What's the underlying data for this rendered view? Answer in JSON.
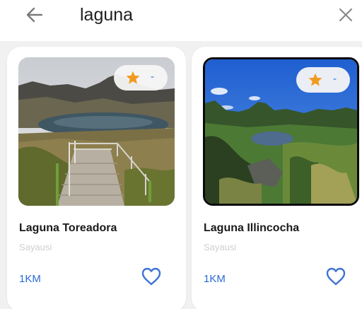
{
  "header": {
    "search_query": "laguna",
    "back_icon": "arrow-left-icon",
    "clear_icon": "close-icon"
  },
  "colors": {
    "accent": "#2b6bd6",
    "star": "#f29a1f",
    "heart": "#3d73d6"
  },
  "results": [
    {
      "title": "Laguna Toreadora",
      "subtitle": "Sayausi",
      "distance": "1KM",
      "rating": "-",
      "favorite_icon": "heart-outline-icon",
      "rating_icon": "star-icon"
    },
    {
      "title": "Laguna Illincocha",
      "subtitle": "Sayausi",
      "distance": "1KM",
      "rating": "-",
      "favorite_icon": "heart-outline-icon",
      "rating_icon": "star-icon"
    }
  ]
}
